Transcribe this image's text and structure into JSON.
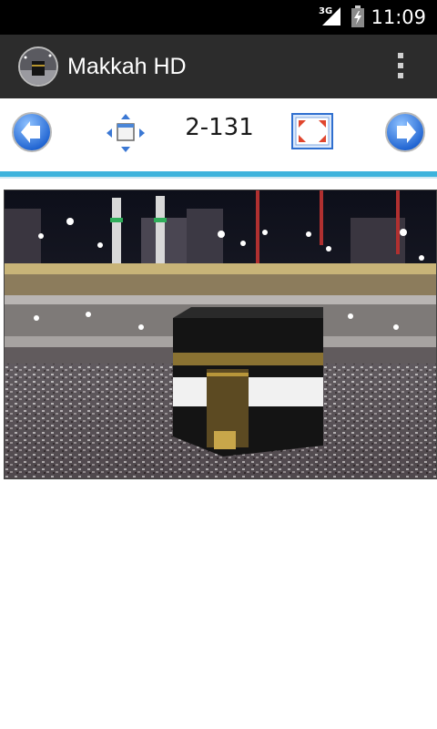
{
  "status_bar": {
    "network": "3G",
    "time": "11:09"
  },
  "app": {
    "title": "Makkah HD",
    "icon": "kaaba-thumbnail-icon"
  },
  "toolbar": {
    "counter": "2-131",
    "icons": [
      "previous-arrow-icon",
      "resize-window-icon",
      "fullscreen-icon",
      "next-arrow-icon"
    ]
  },
  "colors": {
    "action_bar": "#2c2c2c",
    "accent_divider": "#3db3dc",
    "arrow_blue": "#2c73d8"
  },
  "image": {
    "subject": "kaaba-photo"
  }
}
